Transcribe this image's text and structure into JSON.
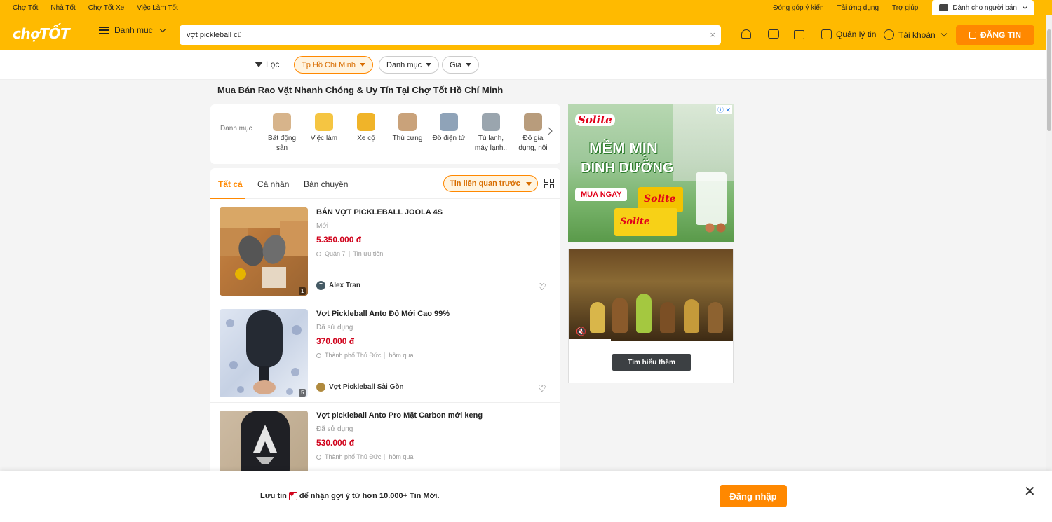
{
  "topbar": {
    "links": [
      "Chợ Tốt",
      "Nhà Tốt",
      "Chợ Tốt Xe",
      "Việc Làm Tốt"
    ],
    "right_links": [
      "Đóng góp ý kiến",
      "Tải ứng dụng",
      "Trợ giúp"
    ],
    "seller_label": "Dành cho người bán"
  },
  "header": {
    "logo": "chợTỐT",
    "menu_label": "Danh mục",
    "search_value": "vợt pickleball cũ",
    "manage_label": "Quản lý tin",
    "account_label": "Tài khoản",
    "post_label": "ĐĂNG TIN"
  },
  "filters": {
    "label": "Lọc",
    "chips": [
      {
        "label": "Tp Hồ Chí Minh",
        "active": true
      },
      {
        "label": "Danh mục",
        "active": false
      },
      {
        "label": "Giá",
        "active": false
      }
    ]
  },
  "page_title": "Mua Bán Rao Vặt Nhanh Chóng & Uy Tín Tại Chợ Tốt Hồ Chí Minh",
  "categories": {
    "label": "Danh mục",
    "items": [
      {
        "label": "Bất động sản",
        "color": "#d7b48b"
      },
      {
        "label": "Việc làm",
        "color": "#f5c542"
      },
      {
        "label": "Xe cộ",
        "color": "#f0b429"
      },
      {
        "label": "Thú cưng",
        "color": "#c9a27a"
      },
      {
        "label": "Đồ điện tử",
        "color": "#8fa3b8"
      },
      {
        "label": "Tủ lạnh, máy lạnh..",
        "color": "#9aa5ae"
      },
      {
        "label": "Đồ gia dụng, nội",
        "color": "#b89c7c"
      }
    ]
  },
  "tabs": {
    "items": [
      "Tất cả",
      "Cá nhân",
      "Bán chuyên"
    ],
    "sort_label": "Tin liên quan trước"
  },
  "listings": [
    {
      "title": "BÁN VỢT PICKLEBALL JOOLA 4S",
      "condition": "Mới",
      "price": "5.350.000 đ",
      "location": "Quận 7",
      "time": "Tin ưu tiên",
      "seller": "Alex Tran",
      "seller_initial": "T",
      "image_count": "1"
    },
    {
      "title": "Vợt Pickleball Anto Độ Mới Cao 99%",
      "condition": "Đã sử dụng",
      "price": "370.000 đ",
      "location": "Thành phố Thủ Đức",
      "time": "hôm qua",
      "seller": "Vợt Pickleball Sài Gòn",
      "seller_initial": "",
      "image_count": "5"
    },
    {
      "title": "Vợt pickleball Anto Pro Mặt Carbon mới keng",
      "condition": "Đã sử dụng",
      "price": "530.000 đ",
      "location": "Thành phố Thủ Đức",
      "time": "hôm qua",
      "seller": "",
      "seller_initial": "",
      "image_count": ""
    }
  ],
  "ads": {
    "ad1": {
      "brand": "Solite",
      "headline1": "MỀM MỊN",
      "headline2": "DINH DƯỠNG",
      "cta": "MUA NGAY",
      "pack_brand": "Solite"
    },
    "ad2": {
      "cta": "Tìm hiểu thêm"
    }
  },
  "bottom_banner": {
    "message_before": "Lưu tin",
    "message_after": "để nhận gợi ý từ hơn 10.000+ Tin Mới.",
    "login_label": "Đăng nhập"
  },
  "colors": {
    "brand_yellow": "#ffba00",
    "accent_orange": "#ff8800",
    "price_red": "#d0021b"
  }
}
